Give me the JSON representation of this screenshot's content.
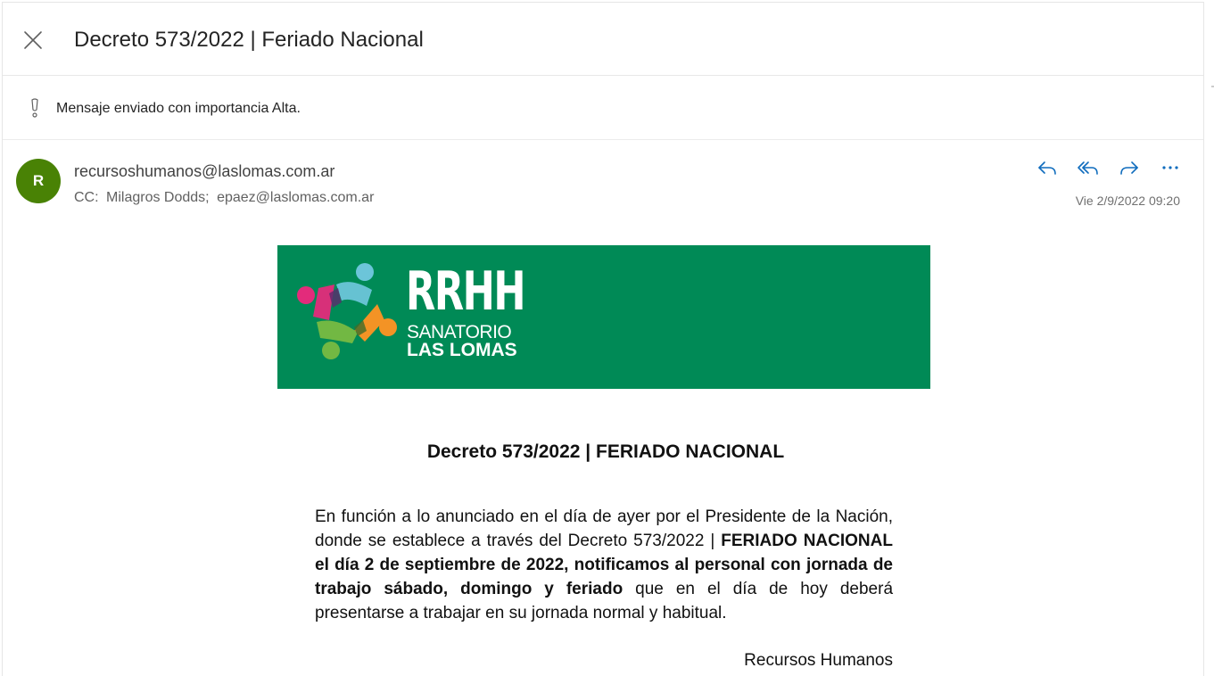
{
  "header": {
    "subject": "Decreto 573/2022 | Feriado Nacional"
  },
  "importance": {
    "text": "Mensaje enviado con importancia Alta."
  },
  "message": {
    "avatar_initial": "R",
    "from": "recursoshumanos@laslomas.com.ar",
    "cc_label": "CC:",
    "cc_recipients": [
      "Milagros Dodds;",
      "epaez@laslomas.com.ar"
    ],
    "date": "Vie 2/9/2022 09:20",
    "avatar_color": "#498205",
    "action_color": "#0f6cbd"
  },
  "banner": {
    "background": "#008a56",
    "title": "RRHH",
    "line1": "SANATORIO",
    "line2": "LAS LOMAS"
  },
  "body": {
    "title": "Decreto 573/2022 | FERIADO NACIONAL",
    "p_plain_1": "En función a lo anunciado en el día de ayer por el Presidente de la Nación, donde se establece a través del Decreto 573/2022 | ",
    "p_bold": "FERIADO NACIONAL el día 2 de septiembre de 2022, notificamos al personal con jornada de trabajo sábado, domingo y feriado",
    "p_plain_2": " que en el día de hoy deberá presentarse a trabajar en su jornada normal y habitual.",
    "signature": "Recursos Humanos"
  },
  "icons": [
    "close-icon",
    "importance-icon",
    "reply-icon",
    "reply-all-icon",
    "forward-icon",
    "more-icon"
  ]
}
